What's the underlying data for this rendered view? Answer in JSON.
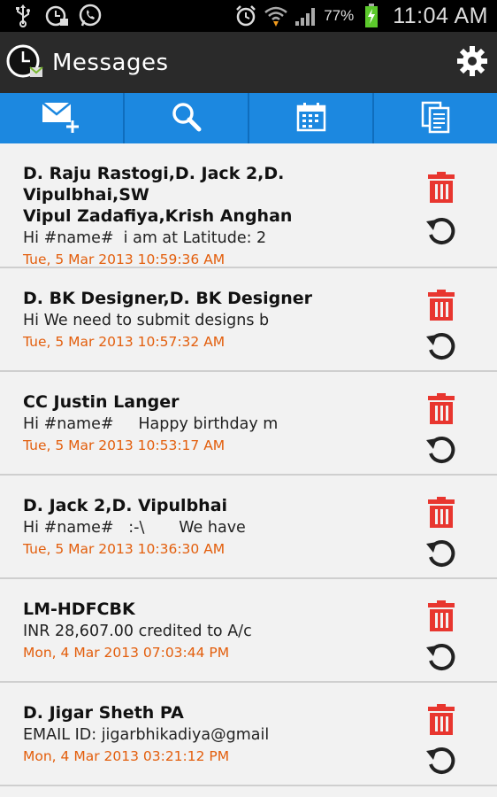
{
  "status_bar": {
    "left_icons": [
      "usb-icon",
      "alarm-clock-app-icon",
      "whatsapp-icon"
    ],
    "right_icons": [
      "alarm-icon",
      "wifi-icon",
      "signal-icon",
      "battery-charging-icon"
    ],
    "battery": "77%",
    "time": "11:04 AM"
  },
  "header": {
    "title": "Messages",
    "settings_icon": "gear-icon"
  },
  "toolbar": {
    "items": [
      {
        "name": "compose",
        "icon": "new-message-icon"
      },
      {
        "name": "search",
        "icon": "search-icon"
      },
      {
        "name": "calendar",
        "icon": "calendar-icon"
      },
      {
        "name": "copy",
        "icon": "copy-icon"
      }
    ]
  },
  "messages": [
    {
      "name_line1": "D. Raju Rastogi,D. Jack 2,D. Vipulbhai,SW",
      "name_line2": "Vipul Zadafiya,Krish Anghan",
      "preview": "Hi #name#  i am at Latitude: 2",
      "date": "Tue, 5 Mar 2013 10:59:36 AM"
    },
    {
      "name_line1": "D. BK Designer,D. BK Designer",
      "preview": "Hi We need to submit designs b",
      "date": "Tue, 5 Mar 2013 10:57:32 AM"
    },
    {
      "name_line1": "CC Justin Langer",
      "preview": "Hi #name#     Happy birthday m",
      "date": "Tue, 5 Mar 2013 10:53:17 AM"
    },
    {
      "name_line1": "D. Jack 2,D. Vipulbhai",
      "preview": "Hi #name#   :-\\       We have",
      "date": "Tue, 5 Mar 2013 10:36:30 AM"
    },
    {
      "name_line1": "LM-HDFCBK",
      "preview": "INR 28,607.00 credited to A/c",
      "date": "Mon, 4 Mar 2013 07:03:44 PM"
    },
    {
      "name_line1": "D. Jigar Sheth PA",
      "preview": "EMAIL ID: jigarbhikadiya@gmail",
      "date": "Mon, 4 Mar 2013 03:21:12 PM"
    }
  ],
  "colors": {
    "toolbar": "#1c88e0",
    "date_text": "#e35e0c",
    "delete_icon": "#e8362f",
    "actionbar": "#2a2a2a"
  }
}
